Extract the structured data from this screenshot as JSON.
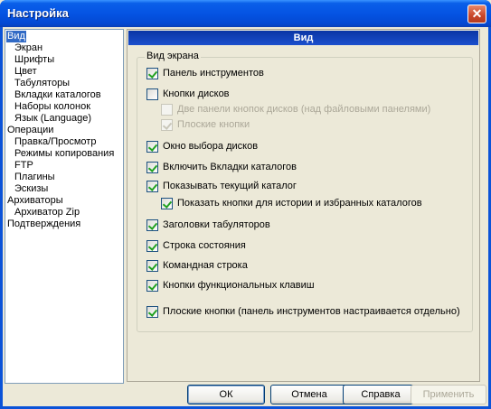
{
  "window": {
    "title": "Настройка",
    "close_glyph": "✕"
  },
  "tree": {
    "items": [
      {
        "label": "Вид",
        "level": 0,
        "selected": true
      },
      {
        "label": "Экран",
        "level": 1
      },
      {
        "label": "Шрифты",
        "level": 1
      },
      {
        "label": "Цвет",
        "level": 1
      },
      {
        "label": "Табуляторы",
        "level": 1
      },
      {
        "label": "Вкладки каталогов",
        "level": 1
      },
      {
        "label": "Наборы колонок",
        "level": 1
      },
      {
        "label": "Язык (Language)",
        "level": 1
      },
      {
        "label": "Операции",
        "level": 0
      },
      {
        "label": "Правка/Просмотр",
        "level": 1
      },
      {
        "label": "Режимы копирования",
        "level": 1
      },
      {
        "label": "FTP",
        "level": 1
      },
      {
        "label": "Плагины",
        "level": 1
      },
      {
        "label": "Эскизы",
        "level": 1
      },
      {
        "label": "Архиваторы",
        "level": 0
      },
      {
        "label": "Архиватор Zip",
        "level": 1
      },
      {
        "label": "Подтверждения",
        "level": 0
      }
    ]
  },
  "panel": {
    "header": "Вид",
    "group_title": "Вид экрана",
    "options": [
      {
        "label": "Панель инструментов",
        "checked": true,
        "disabled": false
      },
      {
        "label": "Кнопки дисков",
        "checked": false,
        "disabled": false
      },
      {
        "label": "Две панели кнопок дисков (над файловыми панелями)",
        "checked": false,
        "disabled": true
      },
      {
        "label": "Плоские кнопки",
        "checked": true,
        "disabled": true
      },
      {
        "label": "Окно выбора дисков",
        "checked": true,
        "disabled": false
      },
      {
        "label": "Включить Вкладки каталогов",
        "checked": true,
        "disabled": false
      },
      {
        "label": "Показывать текущий каталог",
        "checked": true,
        "disabled": false
      },
      {
        "label": "Показать кнопки для истории и избранных каталогов",
        "checked": true,
        "disabled": false
      },
      {
        "label": "Заголовки табуляторов",
        "checked": true,
        "disabled": false
      },
      {
        "label": "Строка состояния",
        "checked": true,
        "disabled": false
      },
      {
        "label": "Командная строка",
        "checked": true,
        "disabled": false
      },
      {
        "label": "Кнопки функциональных клавиш",
        "checked": true,
        "disabled": false
      },
      {
        "label": "Плоские кнопки (панель инструментов настраивается отдельно)",
        "checked": true,
        "disabled": false
      }
    ]
  },
  "buttons": {
    "ok": "ОК",
    "cancel": "Отмена",
    "help": "Справка",
    "apply": "Применить"
  }
}
